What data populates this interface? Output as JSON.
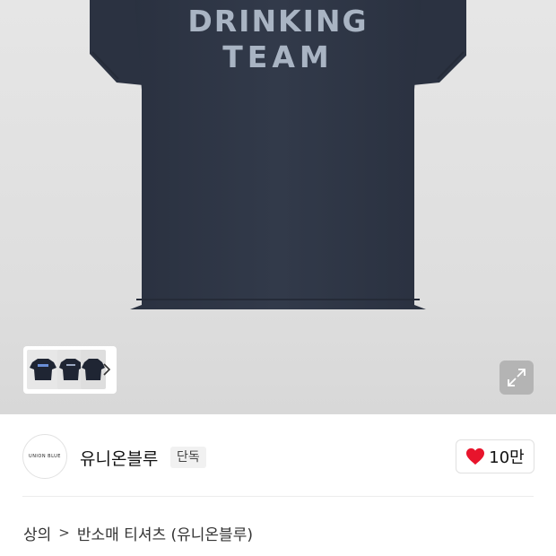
{
  "product": {
    "shirt_print_line1": "DRINKING",
    "shirt_print_line2": "TEAM",
    "shirt_color": "#2e3645",
    "print_color": "#a9b4c3"
  },
  "gallery": {
    "thumbnails": [
      {
        "name": "front-view"
      },
      {
        "name": "front-view-2"
      },
      {
        "name": "back-view"
      }
    ],
    "more_icon": "chevron-right-icon",
    "expand_icon": "expand-icon"
  },
  "brand": {
    "logo_text": "UNION BLUE",
    "name": "유니온블루",
    "badge": "단독",
    "likes": "10만",
    "like_icon": "heart-icon",
    "like_color": "#e8142c"
  },
  "breadcrumb": {
    "category": "상의",
    "separator": ">",
    "subcategory": "반소매 티셔츠 (유니온블루)"
  }
}
